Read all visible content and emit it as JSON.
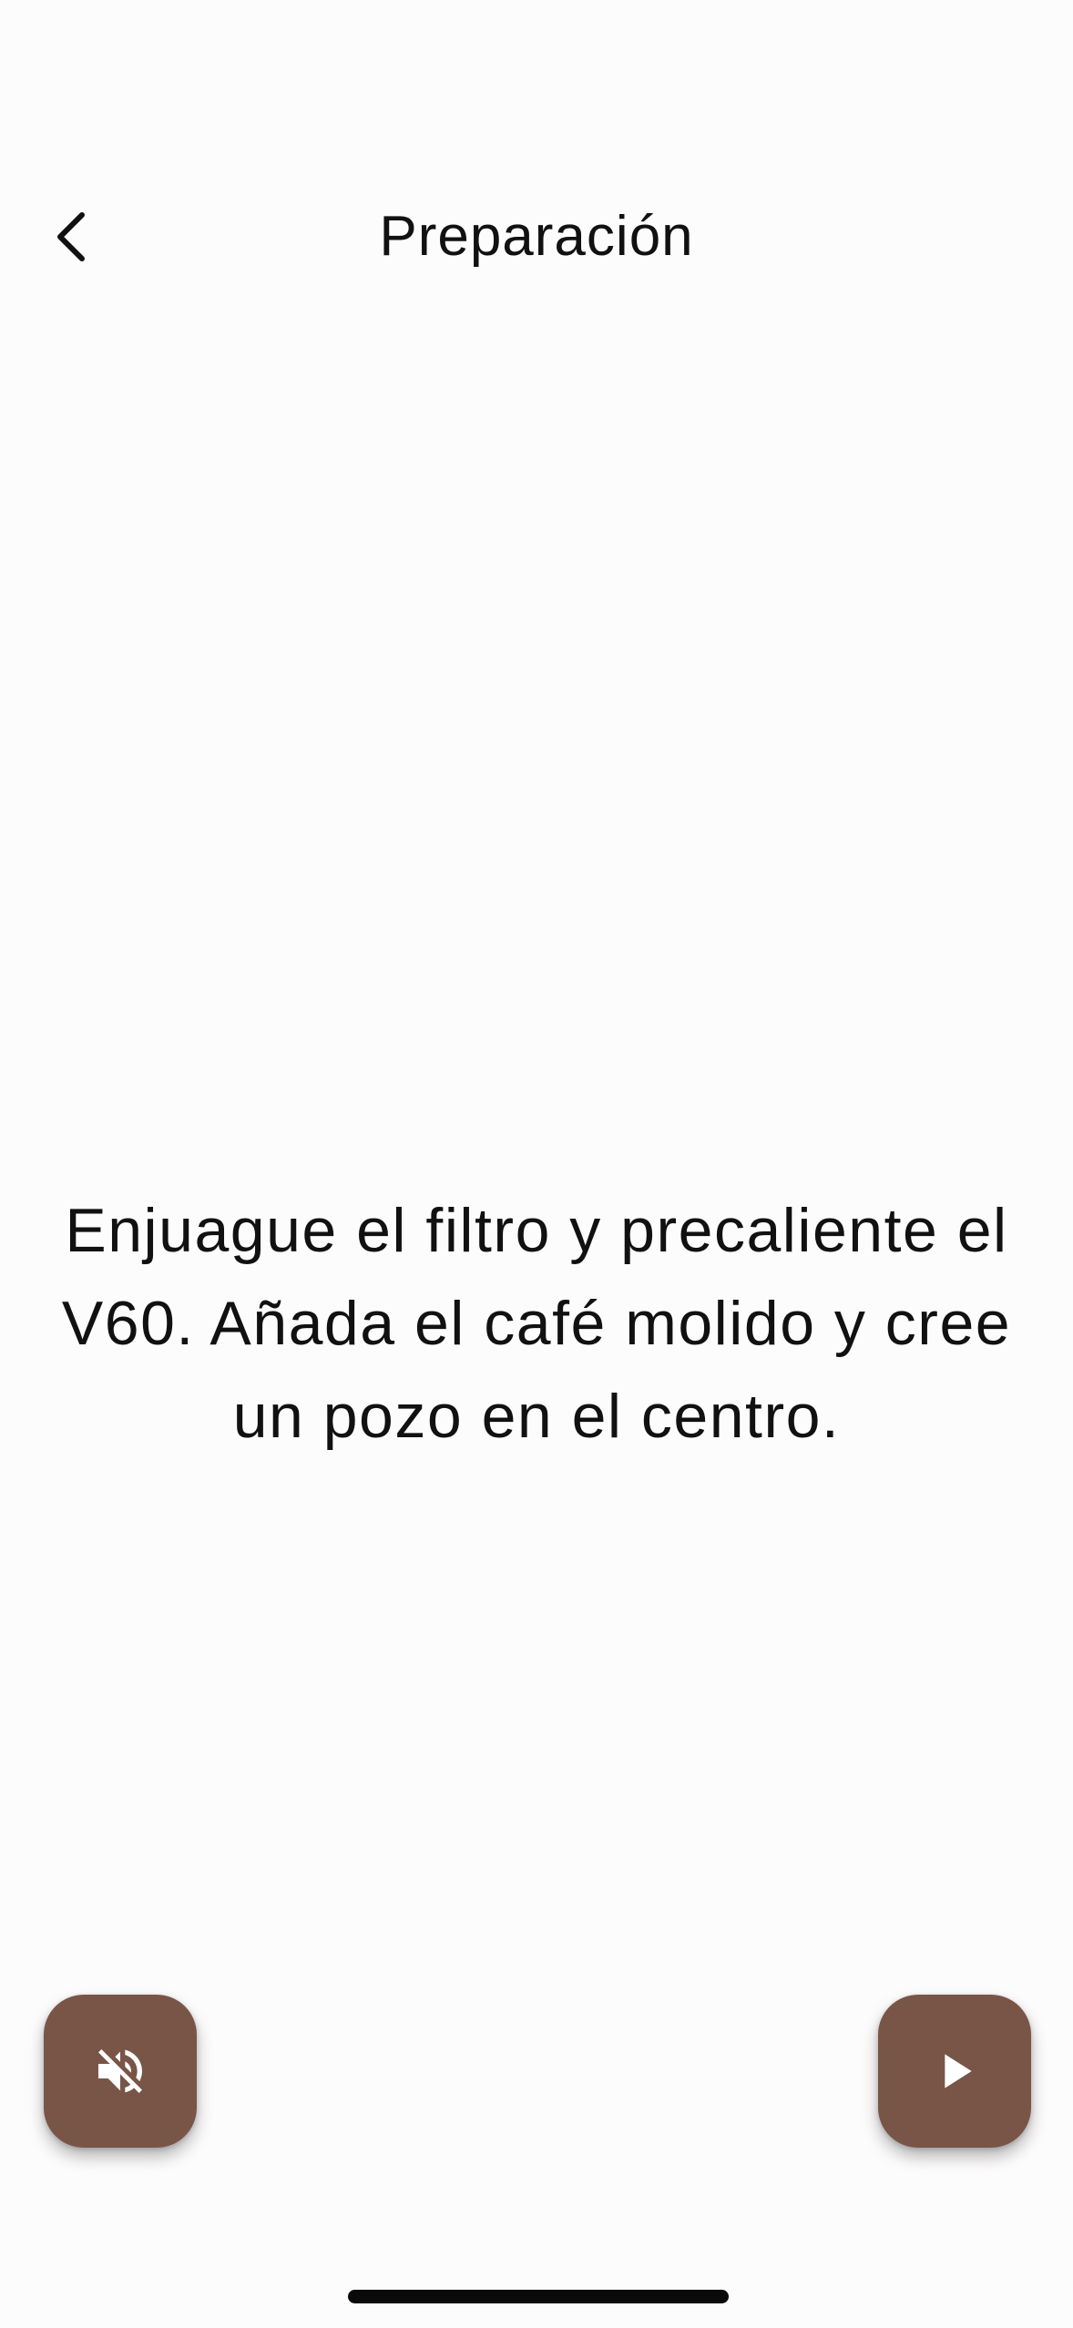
{
  "header": {
    "title": "Preparación",
    "back_icon": "chevron-left-icon"
  },
  "main": {
    "instruction": "Enjuague el filtro y precaliente el V60. Añada el café molido y cree un pozo en el centro."
  },
  "controls": {
    "mute_icon": "volume-off-icon",
    "play_icon": "play-icon",
    "accent_color": "#795548"
  }
}
